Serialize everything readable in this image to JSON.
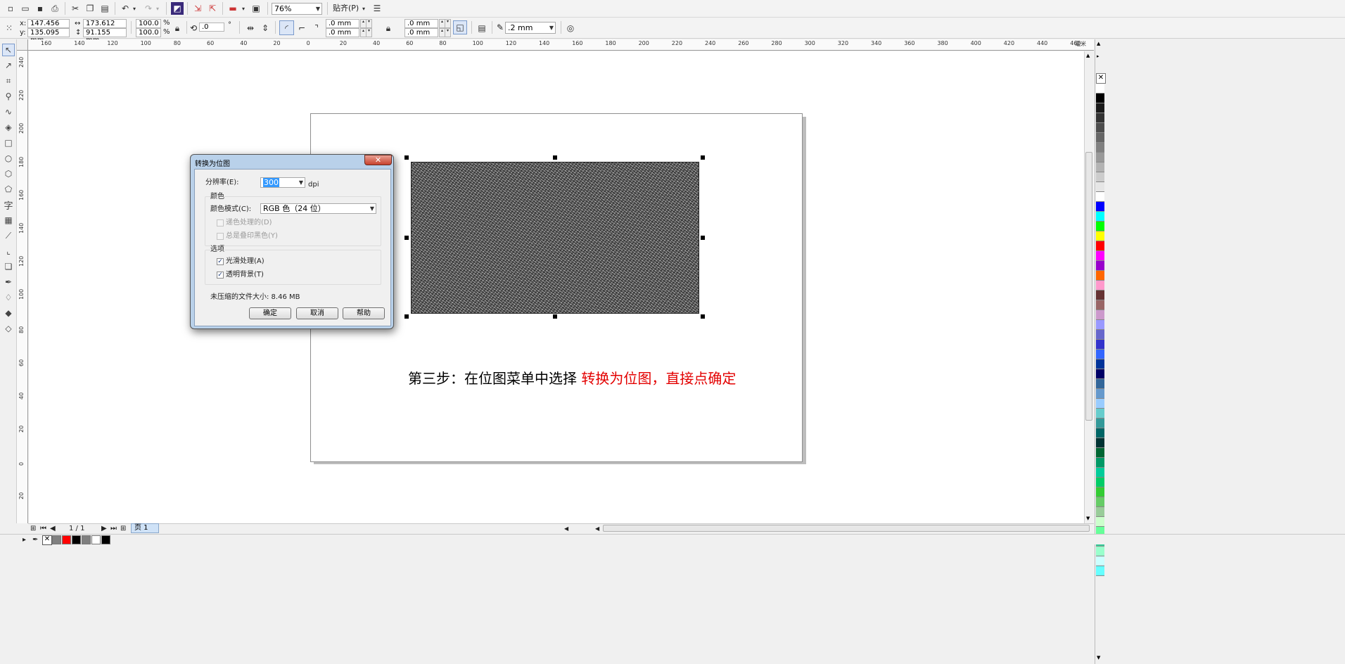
{
  "toolbar": {
    "zoom": "76%",
    "snap_label": "贴齐(P)"
  },
  "propbar": {
    "x_label": "x:",
    "x_value": "147.456 mm",
    "y_label": "y:",
    "y_value": "135.095 mm",
    "width_value": "173.612 mm",
    "height_value": "91.155 mm",
    "scale_x": "100.0",
    "scale_y": "100.0",
    "percent": "%",
    "rotation": ".0",
    "degree": "°",
    "corner1": ".0 mm",
    "corner2": ".0 mm",
    "corner3": ".0 mm",
    "corner4": ".0 mm",
    "outline_width": ".2 mm"
  },
  "hruler_ticks": [
    "160",
    "140",
    "120",
    "100",
    "80",
    "60",
    "40",
    "20",
    "0",
    "20",
    "40",
    "60",
    "80",
    "100",
    "120",
    "140",
    "160",
    "180",
    "200",
    "220",
    "240",
    "260",
    "280",
    "300",
    "320",
    "340",
    "360",
    "380",
    "400",
    "420",
    "440",
    "460"
  ],
  "hruler_unit": "毫米",
  "vruler_ticks": [
    "240",
    "220",
    "200",
    "180",
    "160",
    "140",
    "120",
    "100",
    "80",
    "60",
    "40",
    "20",
    "0",
    "20"
  ],
  "canvas": {
    "caption_black": "第三步：在位图菜单中选择 ",
    "caption_red": "转换为位图，直接点确定"
  },
  "dialog": {
    "title": "转换为位图",
    "close": "✕",
    "resolution_label": "分辨率(E):",
    "resolution_value": "300",
    "dpi": "dpi",
    "color_group": "颜色",
    "color_mode_label": "颜色模式(C):",
    "color_mode_value": "RGB 色（24 位）",
    "dither_label": "递色处理的(D)",
    "overprint_label": "总是叠印黑色(Y)",
    "options_group": "选项",
    "antialias_label": "光滑处理(A)",
    "transparent_label": "透明背景(T)",
    "filesize_label": "未压缩的文件大小: 8.46 MB",
    "ok": "确定",
    "cancel": "取消",
    "help": "帮助"
  },
  "pagebar": {
    "page_count": "1 / 1",
    "page_tab": "页 1"
  },
  "palette_colors": [
    "#ffffff",
    "#000000",
    "#1a1a1a",
    "#333333",
    "#4d4d4d",
    "#666666",
    "#808080",
    "#999999",
    "#b3b3b3",
    "#cccccc",
    "#e6e6e6",
    "#ffffff",
    "#0000ff",
    "#00ffff",
    "#00ff00",
    "#ffff00",
    "#ff0000",
    "#ff00ff",
    "#9900cc",
    "#ff6600",
    "#ff99cc",
    "#663333",
    "#996666",
    "#cc99cc",
    "#9999ff",
    "#6666cc",
    "#3333cc",
    "#3366ff",
    "#003399",
    "#000066",
    "#336699",
    "#6699cc",
    "#99ccff",
    "#66cccc",
    "#339999",
    "#006666",
    "#003333",
    "#006633",
    "#009966",
    "#00cc99",
    "#00cc66",
    "#33cc33",
    "#66cc66",
    "#99cc99",
    "#ccffcc",
    "#66ff99",
    "#33cc99",
    "#99ffcc",
    "#ccffff",
    "#66ffff"
  ],
  "doc_palette": [
    "#808080",
    "#ff0000",
    "#000000",
    "#7f7f7f",
    "#ffffff",
    "#000000"
  ]
}
